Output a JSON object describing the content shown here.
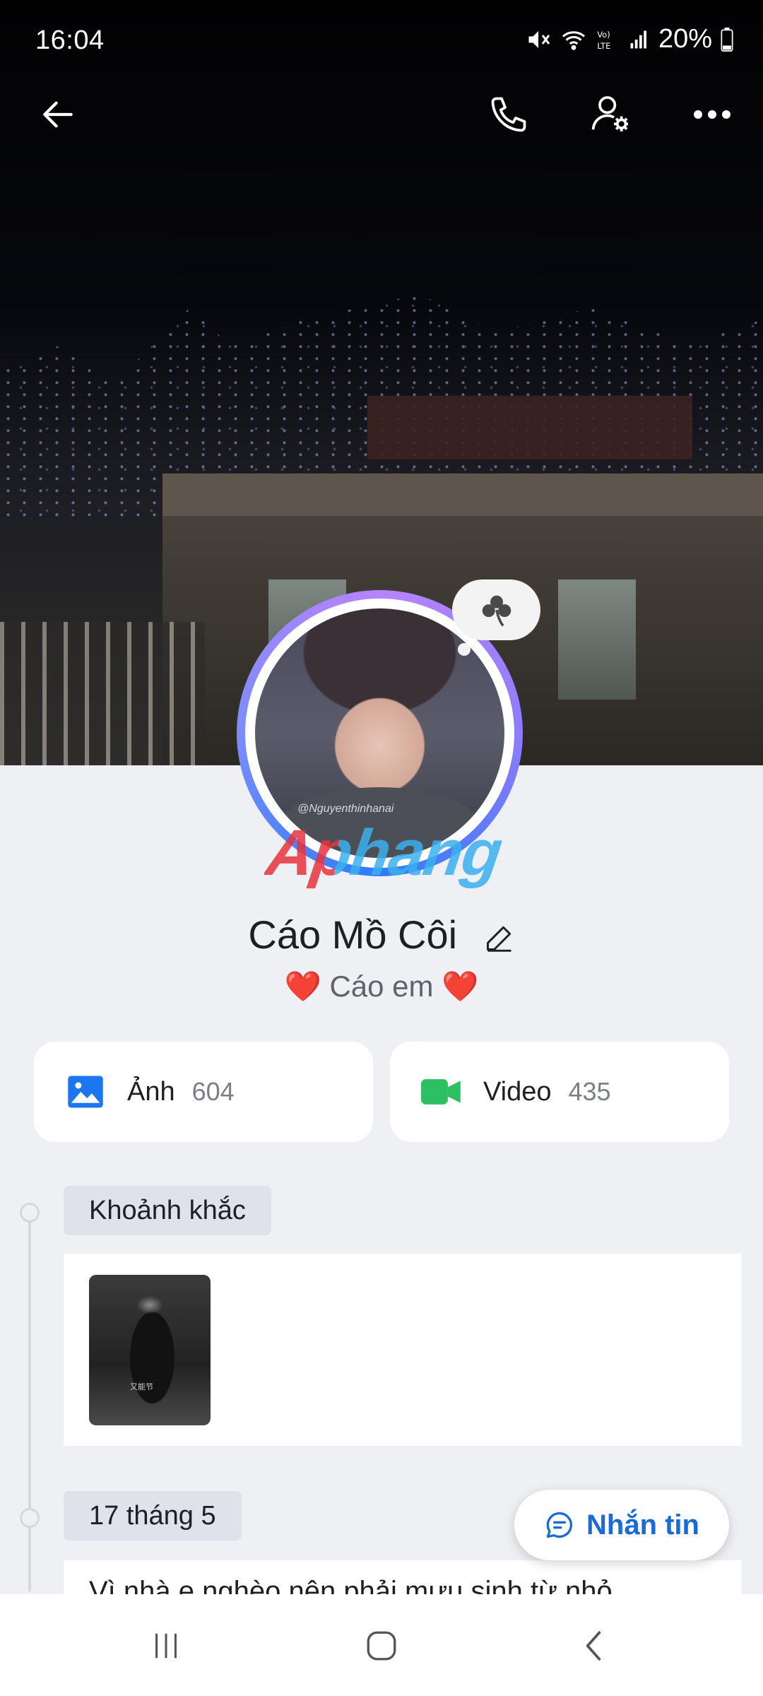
{
  "status_bar": {
    "time": "16:04",
    "battery": "20%",
    "icons": [
      "mute-icon",
      "wifi-icon",
      "volte-icon",
      "signal-icon",
      "battery-icon"
    ]
  },
  "top_bar": {
    "icons": [
      "back-arrow-icon",
      "phone-icon",
      "user-settings-icon",
      "more-icon"
    ]
  },
  "profile": {
    "avatar_tag": "@Nguyenthinhanai",
    "mood_icon": "clover-icon",
    "watermark": "Aphang",
    "name": "Cáo Mồ Côi",
    "status": "❤️ Cáo em ❤️"
  },
  "media": {
    "photos": {
      "label": "Ảnh",
      "count": "604",
      "icon": "photo-icon",
      "color": "#1b76f0"
    },
    "videos": {
      "label": "Video",
      "count": "435",
      "icon": "video-camera-icon",
      "color": "#2fbf63"
    }
  },
  "timeline": {
    "moments": {
      "label": "Khoảnh khắc",
      "thumb_caption": "又能节"
    },
    "date_section": {
      "label": "17 tháng 5",
      "post_text": "Vì nhà e nghèo nên phải mưu sinh từ nhỏ"
    }
  },
  "message_button": {
    "label": "Nhắn tin",
    "icon": "chat-bubble-icon",
    "color": "#1a6bd6"
  },
  "nav_bar": {
    "icons": [
      "recent-apps-icon",
      "home-icon",
      "back-icon"
    ]
  }
}
